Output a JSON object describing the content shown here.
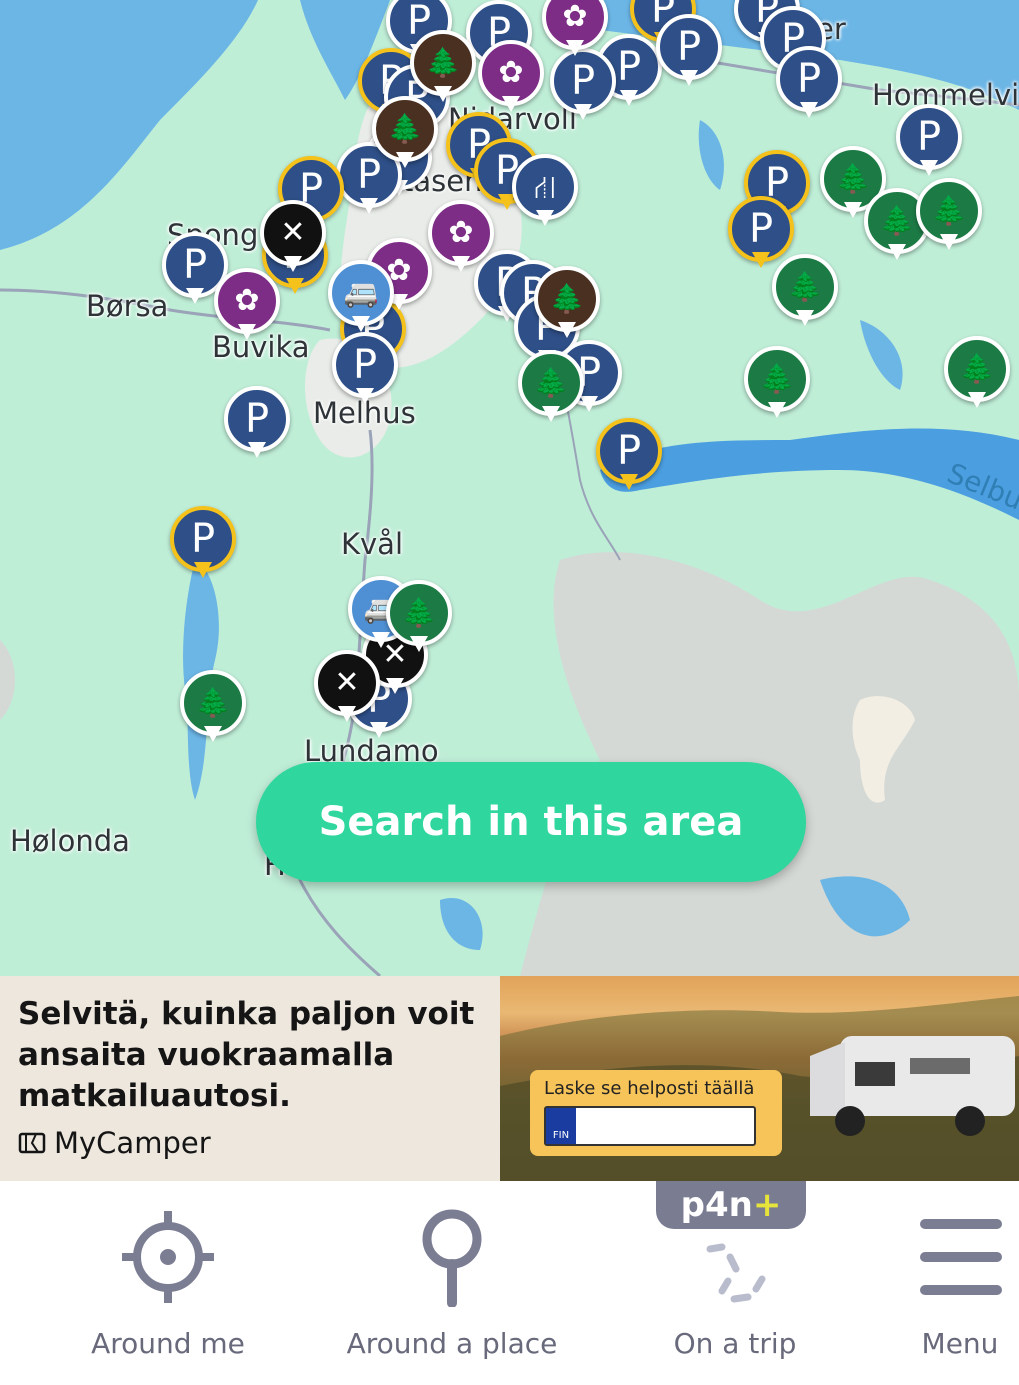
{
  "map": {
    "places": {
      "hommelvik": "Hommelvi",
      "borsa": "Børsa",
      "buvika": "Buvika",
      "melhus": "Melhus",
      "kval": "Kvål",
      "lundamo": "Lundamo",
      "holonda": "Hølonda",
      "spongdal": "Spong",
      "nidarvoll": "Nidarvoll",
      "tiller": "tåsen",
      "ranheim": "er",
      "selbu": "Selbu",
      "h": "H"
    },
    "marker_glyphs": {
      "parking": "P",
      "tree": "🌲",
      "service": "✿",
      "highway": "⛙",
      "camp": "✕",
      "van": "🚐"
    }
  },
  "search_button": {
    "label": "Search in this area"
  },
  "ad": {
    "headline": "Selvitä, kuinka paljon voit ansaita vuokraamalla matkailuautosi.",
    "brand": "MyCamper",
    "card_label": "Laske se helposti täällä",
    "plate_country": "FIN"
  },
  "nav": {
    "items": [
      {
        "label": "Around me",
        "icon": "crosshair-icon"
      },
      {
        "label": "Around a place",
        "icon": "map-pin-icon"
      },
      {
        "label": "On a trip",
        "icon": "loading-route-icon"
      },
      {
        "label": "Menu",
        "icon": "hamburger-icon"
      }
    ],
    "badge": {
      "text": "p4n",
      "plus": "+"
    }
  }
}
